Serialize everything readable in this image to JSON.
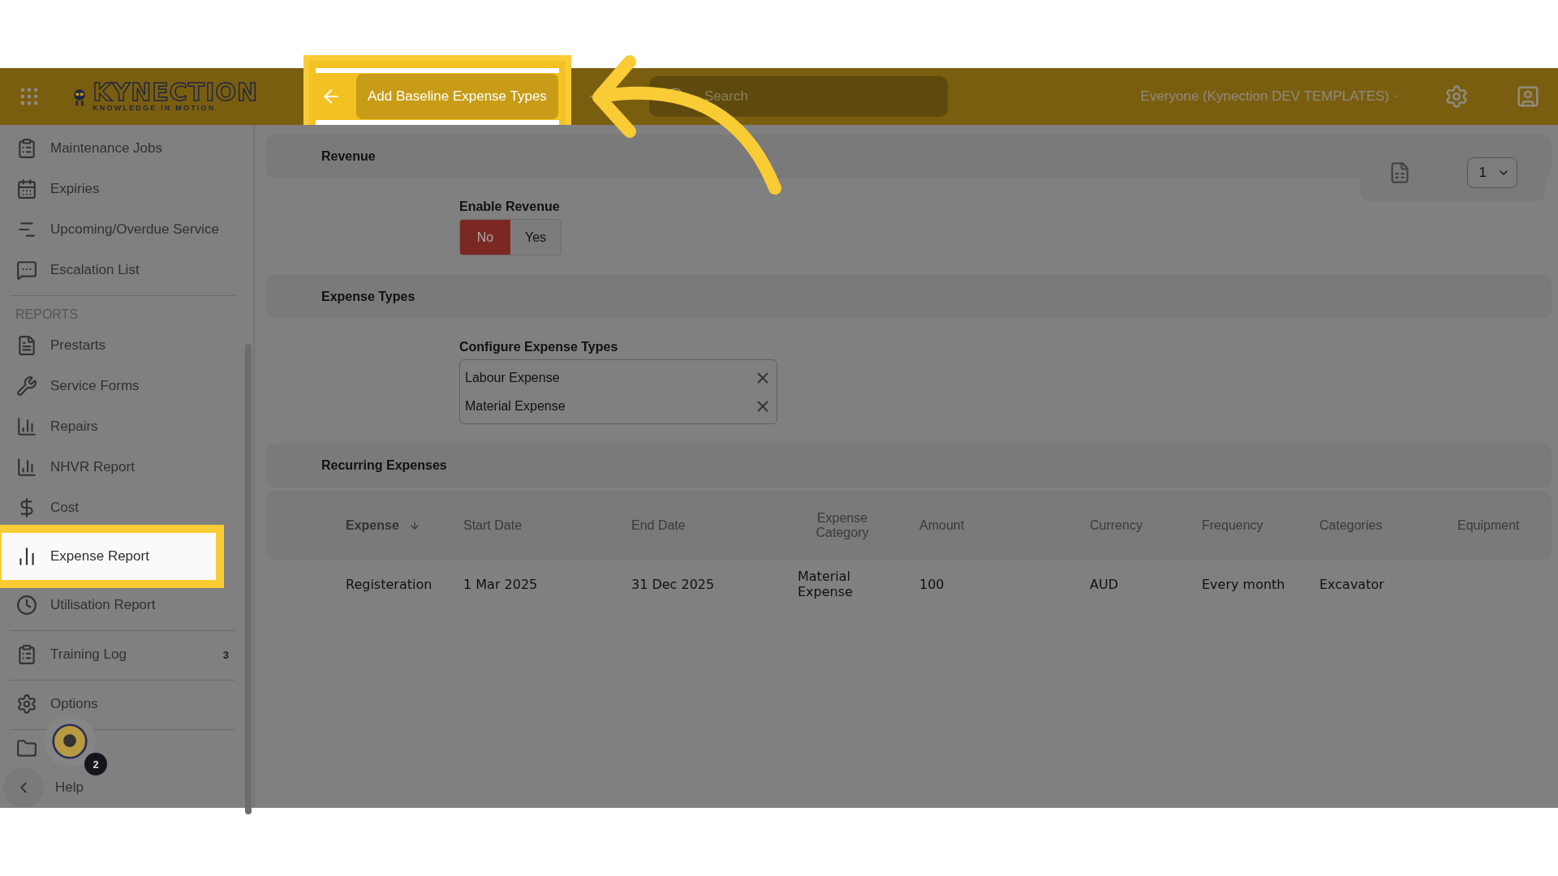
{
  "header": {
    "logo_name": "KYNECTION",
    "logo_tagline": "KNOWLEDGE IN MOTION",
    "action_button": "Add Baseline Expense Types",
    "search": {
      "placeholder": "Search"
    },
    "org_selector": "Everyone (Kynection DEV TEMPLATES)"
  },
  "sidebar": {
    "groups": [
      {
        "items": [
          {
            "label": "Maintenance Jobs",
            "selected": false
          },
          {
            "label": "Expiries",
            "selected": false
          },
          {
            "label": "Upcoming/Overdue Service",
            "selected": false
          },
          {
            "label": "Escalation List",
            "selected": false
          }
        ]
      },
      {
        "heading": "REPORTS",
        "items": [
          {
            "label": "Prestarts",
            "selected": false
          },
          {
            "label": "Service Forms",
            "selected": false
          },
          {
            "label": "Repairs",
            "selected": false
          },
          {
            "label": "NHVR Report",
            "selected": false
          },
          {
            "label": "Cost",
            "selected": false
          },
          {
            "label": "Expense Report",
            "selected": true
          },
          {
            "label": "Utilisation Report",
            "selected": false
          }
        ]
      },
      {
        "items": [
          {
            "label": "Training Log",
            "selected": false,
            "badge": "3"
          }
        ]
      },
      {
        "items": [
          {
            "label": "Options",
            "selected": false
          }
        ]
      }
    ],
    "help": "Help",
    "assistant_badge": "2"
  },
  "toolbar": {
    "page_select": "1"
  },
  "revenue": {
    "title": "Revenue",
    "field_label": "Enable Revenue",
    "options": [
      {
        "label": "No",
        "selected": true
      },
      {
        "label": "Yes",
        "selected": false
      }
    ]
  },
  "expense_types": {
    "title": "Expense Types",
    "field_label": "Configure Expense Types",
    "tags": [
      "Labour Expense",
      "Material Expense"
    ]
  },
  "recurring": {
    "title": "Recurring Expenses",
    "columns": [
      {
        "label": "Expense",
        "sorted": true
      },
      {
        "label": "Start Date",
        "sorted": false
      },
      {
        "label": "End Date",
        "sorted": false
      },
      {
        "label": "Expense Category",
        "sorted": false
      },
      {
        "label": "Amount",
        "sorted": false
      },
      {
        "label": "Currency",
        "sorted": false
      },
      {
        "label": "Frequency",
        "sorted": false
      },
      {
        "label": "Categories",
        "sorted": false
      },
      {
        "label": "Equipment",
        "sorted": false
      }
    ],
    "rows": [
      [
        "Registeration",
        "1 Mar 2025",
        "31 Dec 2025",
        "Material Expense",
        "100",
        "AUD",
        "Every month",
        "Excavator"
      ]
    ]
  }
}
